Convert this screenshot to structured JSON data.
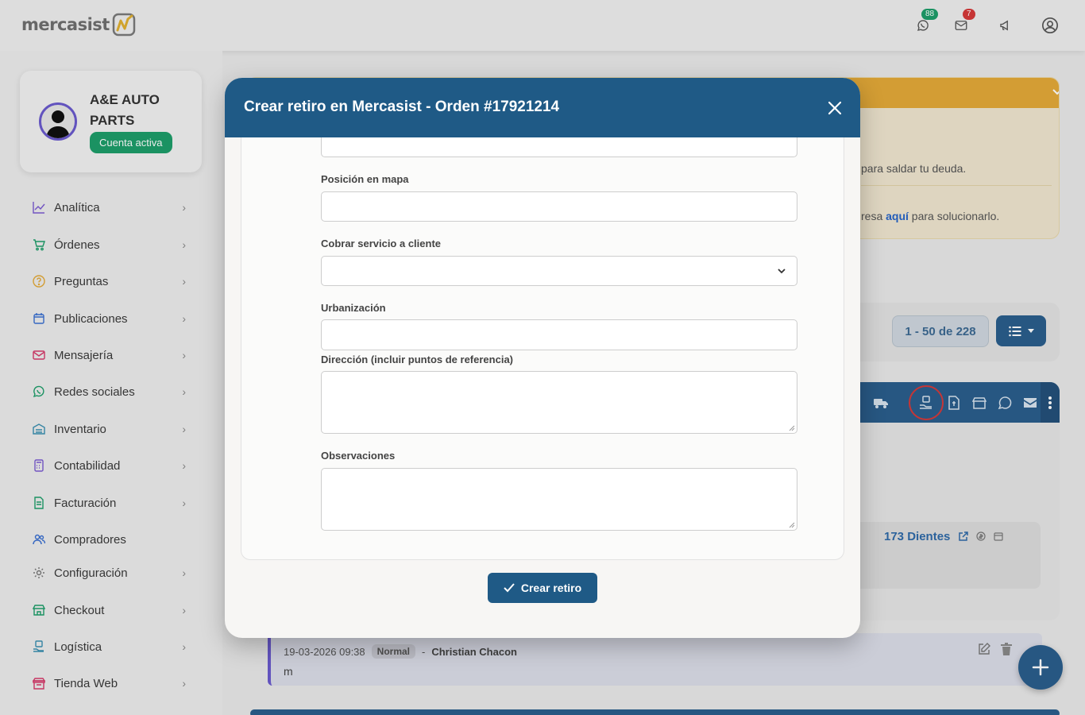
{
  "app": {
    "logo_text": "mercasist",
    "whatsapp_count": "88",
    "mail_count": "7"
  },
  "profile": {
    "company": "A&E AUTO PARTS",
    "status": "Cuenta activa"
  },
  "nav": {
    "items": [
      {
        "label": "Analítica",
        "icon": "chart-line-icon"
      },
      {
        "label": "Órdenes",
        "icon": "cart-icon"
      },
      {
        "label": "Preguntas",
        "icon": "question-circle-icon"
      },
      {
        "label": "Publicaciones",
        "icon": "calendar-icon"
      },
      {
        "label": "Mensajería",
        "icon": "envelope-icon"
      },
      {
        "label": "Redes sociales",
        "icon": "whatsapp-icon"
      },
      {
        "label": "Inventario",
        "icon": "warehouse-icon"
      },
      {
        "label": "Contabilidad",
        "icon": "calculator-icon"
      },
      {
        "label": "Facturación",
        "icon": "invoice-icon"
      },
      {
        "label": "Compradores",
        "icon": "users-icon"
      },
      {
        "label": "Configuración",
        "icon": "gear-icon"
      },
      {
        "label": "Checkout",
        "icon": "store-icon"
      },
      {
        "label": "Logística",
        "icon": "box-hand-icon"
      },
      {
        "label": "Tienda Web",
        "icon": "shop-icon"
      }
    ]
  },
  "background": {
    "warning_line1": "para saldar tu deuda.",
    "warning_line2_pre": "resa ",
    "warning_line2_link": "aquí",
    "warning_line2_post": " para solucionarlo.",
    "pager": "1 - 50 de 228",
    "product_link": "173 Dientes",
    "note": {
      "timestamp": "19-03-2026 09:38",
      "priority": "Normal",
      "separator": "-",
      "author": "Christian Chacon",
      "body": "m"
    }
  },
  "modal": {
    "title": "Crear retiro en Mercasist - Orden #17921214",
    "fields": {
      "posicion_label": "Posición en mapa",
      "posicion_value": "",
      "cobrar_label": "Cobrar servicio a cliente",
      "cobrar_value": "",
      "urbanizacion_label": "Urbanización",
      "urbanizacion_value": "",
      "direccion_label": "Dirección (incluir puntos de referencia)",
      "direccion_value": "",
      "observaciones_label": "Observaciones",
      "observaciones_value": ""
    },
    "submit_label": "Crear retiro"
  },
  "colors": {
    "primary": "#1f5a86",
    "success": "#1e9e6a",
    "warning": "#e3a938",
    "danger": "#d63a3a",
    "accent": "#6a5acd"
  }
}
